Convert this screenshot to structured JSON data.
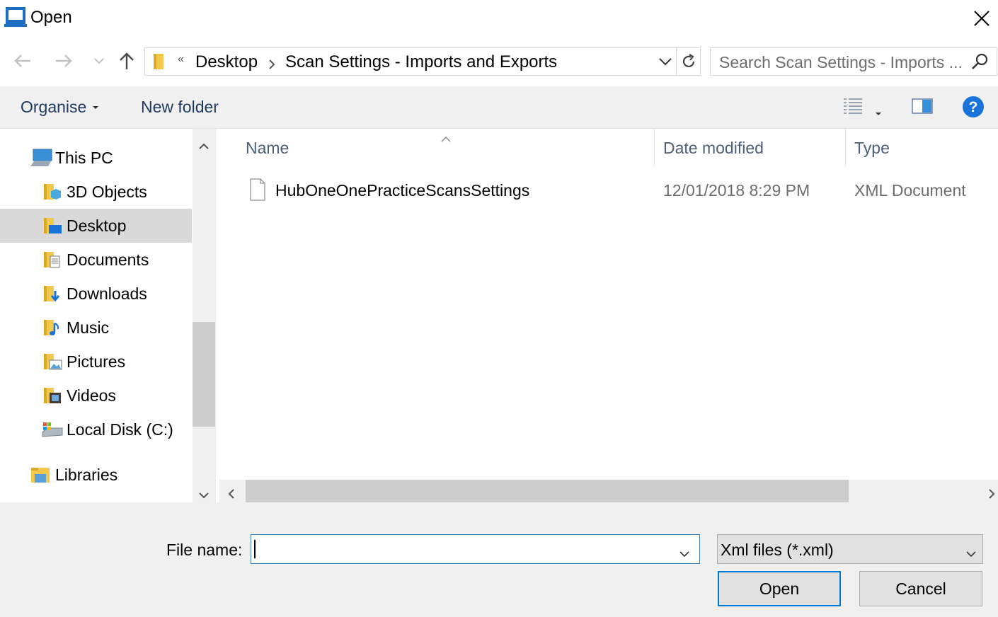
{
  "window": {
    "title": "Open"
  },
  "nav": {
    "back_icon": "arrow-left-icon",
    "forward_icon": "arrow-right-icon",
    "recent_icon": "chevron-down-icon",
    "up_icon": "arrow-up-icon"
  },
  "address": {
    "overflow": "«",
    "crumbs": [
      "Desktop",
      "Scan Settings - Imports and Exports"
    ]
  },
  "search": {
    "placeholder": "Search Scan Settings - Imports ..."
  },
  "toolbar": {
    "organise_label": "Organise",
    "new_folder_label": "New folder"
  },
  "sidebar": {
    "items": [
      {
        "label": "This PC",
        "icon": "computer-icon"
      },
      {
        "label": "3D Objects",
        "icon": "3d-objects-folder-icon"
      },
      {
        "label": "Desktop",
        "icon": "desktop-folder-icon",
        "selected": true
      },
      {
        "label": "Documents",
        "icon": "documents-folder-icon"
      },
      {
        "label": "Downloads",
        "icon": "downloads-folder-icon"
      },
      {
        "label": "Music",
        "icon": "music-folder-icon"
      },
      {
        "label": "Pictures",
        "icon": "pictures-folder-icon"
      },
      {
        "label": "Videos",
        "icon": "videos-folder-icon"
      },
      {
        "label": "Local Disk (C:)",
        "icon": "local-disk-icon"
      },
      {
        "label": "Libraries",
        "icon": "libraries-icon"
      }
    ]
  },
  "filelist": {
    "columns": [
      "Name",
      "Date modified",
      "Type"
    ],
    "rows": [
      {
        "name": "HubOneOnePracticeScansSettings",
        "date": "12/01/2018 8:29 PM",
        "type": "XML Document"
      }
    ]
  },
  "footer": {
    "file_name_label": "File name:",
    "file_name_value": "",
    "file_type_value": "Xml files (*.xml)",
    "open_label": "Open",
    "cancel_label": "Cancel"
  },
  "colors": {
    "accent": "#0078d7",
    "selected_bg": "#d9d9d9",
    "panel_bg": "#f0f0f0",
    "help_blue": "#1a73d9"
  }
}
